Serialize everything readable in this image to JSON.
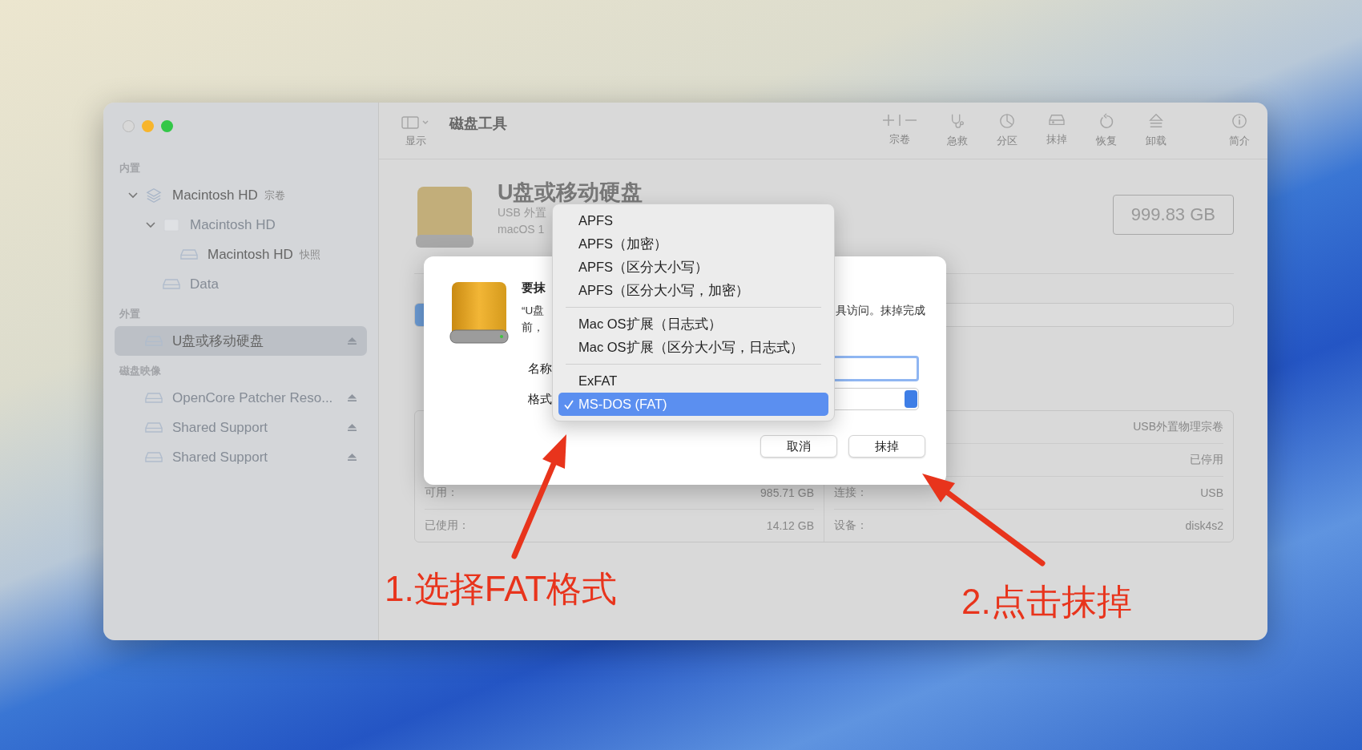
{
  "sidebar": {
    "sections": [
      {
        "title": "内置",
        "items": [
          {
            "label": "Macintosh HD",
            "tag": "宗卷",
            "kind": "container",
            "expanded": true,
            "dimmed": false,
            "selected": false,
            "ejectable": false,
            "children": [
              {
                "label": "Macintosh HD",
                "kind": "group",
                "expanded": true,
                "dimmed": true,
                "selected": false,
                "ejectable": false,
                "children": [
                  {
                    "label": "Macintosh HD",
                    "tag": "快照",
                    "kind": "volume",
                    "dimmed": false,
                    "selected": false,
                    "ejectable": false
                  }
                ]
              },
              {
                "label": "Data",
                "kind": "volume",
                "dimmed": true,
                "selected": false,
                "ejectable": false
              }
            ]
          }
        ]
      },
      {
        "title": "外置",
        "items": [
          {
            "label": "U盘或移动硬盘",
            "kind": "volume",
            "dimmed": false,
            "selected": true,
            "ejectable": true
          }
        ]
      },
      {
        "title": "磁盘映像",
        "items": [
          {
            "label": "OpenCore Patcher Reso...",
            "kind": "volume",
            "dimmed": true,
            "selected": false,
            "ejectable": true
          },
          {
            "label": "Shared Support",
            "kind": "volume",
            "dimmed": true,
            "selected": false,
            "ejectable": true
          },
          {
            "label": "Shared Support",
            "kind": "volume",
            "dimmed": true,
            "selected": false,
            "ejectable": true
          }
        ]
      }
    ]
  },
  "toolbar": {
    "view_label": "显示",
    "title": "磁盘工具",
    "actions": [
      {
        "label": "宗卷",
        "kind": "volume"
      },
      {
        "label": "急救",
        "kind": "firstaid"
      },
      {
        "label": "分区",
        "kind": "partition"
      },
      {
        "label": "抹掉",
        "kind": "erase"
      },
      {
        "label": "恢复",
        "kind": "restore"
      },
      {
        "label": "卸载",
        "kind": "unmount"
      },
      {
        "label": "简介",
        "kind": "info"
      }
    ]
  },
  "disk": {
    "title": "U盘或移动硬盘",
    "subtitle": "USB 外置",
    "detail": "macOS 1",
    "capacity": "999.83 GB"
  },
  "info": {
    "left": [
      {
        "label": "可用：",
        "value": "985.71 GB"
      },
      {
        "label": "已使用：",
        "value": "14.12 GB"
      }
    ],
    "right": [
      {
        "value": "USB外置物理宗卷"
      },
      {
        "value": "已停用"
      },
      {
        "label": "连接：",
        "value": "USB"
      },
      {
        "label": "设备：",
        "value": "disk4s2"
      }
    ]
  },
  "dialog": {
    "title": "要抹",
    "message_left": [
      "“U盘",
      "前，"
    ],
    "message_right": "具访问。抹掉完成",
    "name_label": "名称",
    "format_label": "格式",
    "buttons": [
      "取消",
      "抹掉"
    ]
  },
  "format_menu": {
    "groups": [
      [
        {
          "label": "APFS",
          "selected": false
        },
        {
          "label": "APFS（加密）",
          "selected": false
        },
        {
          "label": "APFS（区分大小写）",
          "selected": false
        },
        {
          "label": "APFS（区分大小写，加密）",
          "selected": false
        }
      ],
      [
        {
          "label": "Mac OS扩展（日志式）",
          "selected": false
        },
        {
          "label": "Mac OS扩展（区分大小写，日志式）",
          "selected": false
        }
      ],
      [
        {
          "label": "ExFAT",
          "selected": false
        },
        {
          "label": "MS-DOS (FAT)",
          "selected": true
        }
      ]
    ]
  },
  "annotations": [
    {
      "text": "1.选择FAT格式"
    },
    {
      "text": "2.点击抹掉"
    }
  ]
}
